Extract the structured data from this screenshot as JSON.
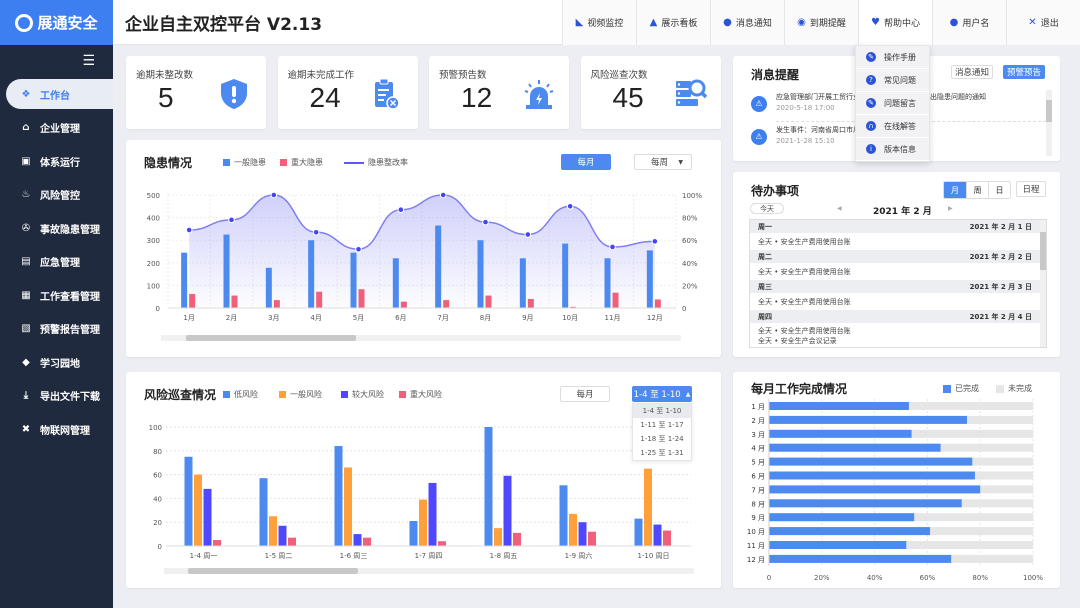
{
  "brand": {
    "name": "展通安全"
  },
  "app_title": "企业自主双控平台 V2.13",
  "nav": [
    {
      "label": "视频监控",
      "icon": "camera-icon"
    },
    {
      "label": "展示看板",
      "icon": "dashboard-icon"
    },
    {
      "label": "消息通知",
      "icon": "message-icon"
    },
    {
      "label": "到期提醒",
      "icon": "alarm-icon"
    },
    {
      "label": "帮助中心",
      "icon": "heart-icon"
    },
    {
      "label": "用户名",
      "icon": "user-icon"
    },
    {
      "label": "退出",
      "icon": "close-icon"
    }
  ],
  "help_menu": [
    {
      "label": "操作手册",
      "icon": "manual-icon"
    },
    {
      "label": "常见问题",
      "icon": "question-icon"
    },
    {
      "label": "问题留言",
      "icon": "edit-icon"
    },
    {
      "label": "在线解答",
      "icon": "headset-icon"
    },
    {
      "label": "版本信息",
      "icon": "info-icon"
    }
  ],
  "sidebar": {
    "items": [
      {
        "label": "工作台",
        "icon": "windows-icon",
        "active": true
      },
      {
        "label": "企业管理",
        "icon": "home-icon"
      },
      {
        "label": "体系运行",
        "icon": "system-icon"
      },
      {
        "label": "风险管控",
        "icon": "fire-icon"
      },
      {
        "label": "事故隐患管理",
        "icon": "hazard-icon"
      },
      {
        "label": "应急管理",
        "icon": "emergency-icon"
      },
      {
        "label": "工作查看管理",
        "icon": "calendar-icon"
      },
      {
        "label": "预警报告管理",
        "icon": "report-icon"
      },
      {
        "label": "学习园地",
        "icon": "graduation-icon"
      },
      {
        "label": "导出文件下载",
        "icon": "download-icon"
      },
      {
        "label": "物联网管理",
        "icon": "network-icon"
      }
    ]
  },
  "stats": [
    {
      "label": "逾期未整改数",
      "value": "5",
      "icon": "shield-alert-icon"
    },
    {
      "label": "逾期未完成工作",
      "value": "24",
      "icon": "clipboard-x-icon"
    },
    {
      "label": "预警预告数",
      "value": "12",
      "icon": "siren-icon"
    },
    {
      "label": "风险巡查次数",
      "value": "45",
      "icon": "server-search-icon"
    }
  ],
  "hazard": {
    "title": "隐患情况",
    "btn_monthly": "每月",
    "select_value": "每周",
    "legend": [
      "一般隐患",
      "重大隐患",
      "隐患整改率"
    ]
  },
  "messages": {
    "title": "消息提醒",
    "btn_notice": "消息通知",
    "btn_warning": "预警预告",
    "items": [
      {
        "text": "应急管理部门开展工贸行业…通报两个层面八类突出隐患问题的通知",
        "time": "2020-5-18   17:00"
      },
      {
        "text": "发生事件：河南省周口市川…测试",
        "time": "2021-1-28   15:10"
      }
    ]
  },
  "todo": {
    "title": "待办事项",
    "view_tabs": [
      "月",
      "周",
      "日"
    ],
    "btn_schedule": "日程",
    "btn_today": "今天",
    "month_label": "2021 年 2 月",
    "days": [
      {
        "weekday": "周一",
        "date": "2021 年 2 月 1 日",
        "events": [
          "全天 • 安全生产费用使用台账"
        ]
      },
      {
        "weekday": "周二",
        "date": "2021 年 2 月 2 日",
        "events": [
          "全天 • 安全生产费用使用台账"
        ]
      },
      {
        "weekday": "周三",
        "date": "2021 年 2 月 3 日",
        "events": [
          "全天 • 安全生产费用使用台账"
        ]
      },
      {
        "weekday": "周四",
        "date": "2021 年 2 月 4 日",
        "events": [
          "全天 • 安全生产费用使用台账",
          "全天 • 安全生产会议记录"
        ]
      }
    ]
  },
  "risk": {
    "title": "风险巡查情况",
    "btn_monthly": "每月",
    "select_value": "1-4 至 1-10",
    "options": [
      "1-4 至 1-10",
      "1-11 至 1-17",
      "1-18 至 1-24",
      "1-25 至 1-31"
    ],
    "legend": [
      "低风险",
      "一般风险",
      "较大风险",
      "重大风险"
    ]
  },
  "completion": {
    "title": "每月工作完成情况",
    "legend": [
      "已完成",
      "未完成"
    ]
  },
  "colors": {
    "accent": "#4d8af0",
    "red": "#f0607a",
    "orange": "#ffa03a",
    "purple": "#5048ff",
    "line": "#5b5bf0"
  },
  "chart_data": [
    {
      "type": "bar",
      "title": "隐患情况",
      "categories": [
        "1月",
        "2月",
        "3月",
        "4月",
        "5月",
        "6月",
        "7月",
        "8月",
        "9月",
        "10月",
        "11月",
        "12月"
      ],
      "series": [
        {
          "name": "一般隐患",
          "type": "bar",
          "values": [
            245,
            325,
            178,
            300,
            245,
            220,
            365,
            300,
            220,
            285,
            220,
            255
          ]
        },
        {
          "name": "重大隐患",
          "type": "bar",
          "values": [
            62,
            55,
            35,
            72,
            83,
            28,
            35,
            55,
            40,
            5,
            68,
            38
          ]
        },
        {
          "name": "隐患整改率",
          "type": "line",
          "axis": "right",
          "values": [
            69,
            78,
            100,
            67,
            52,
            87,
            100,
            76,
            65,
            90,
            54,
            59
          ]
        }
      ],
      "ylim": [
        0,
        500
      ],
      "yticks": [
        0,
        100,
        200,
        300,
        400,
        500
      ],
      "y2lim": [
        0,
        100
      ],
      "y2ticks": [
        "0",
        "20%",
        "40%",
        "60%",
        "80%",
        "100%"
      ]
    },
    {
      "type": "bar",
      "title": "风险巡查情况",
      "categories": [
        "1-4  周一",
        "1-5  周二",
        "1-6  周三",
        "1-7  周四",
        "1-8  周五",
        "1-9  周六",
        "1-10  周日"
      ],
      "series": [
        {
          "name": "低风险",
          "values": [
            75,
            57,
            84,
            21,
            100,
            51,
            23
          ]
        },
        {
          "name": "一般风险",
          "values": [
            60,
            25,
            66,
            39,
            15,
            27,
            65
          ]
        },
        {
          "name": "较大风险",
          "values": [
            48,
            17,
            10,
            53,
            59,
            20,
            18
          ]
        },
        {
          "name": "重大风险",
          "values": [
            5,
            7,
            7,
            4,
            11,
            12,
            13
          ]
        }
      ],
      "ylim": [
        0,
        100
      ],
      "yticks": [
        0,
        20,
        40,
        60,
        80,
        100
      ]
    },
    {
      "type": "bar",
      "orientation": "horizontal",
      "title": "每月工作完成情况",
      "categories": [
        "1 月",
        "2 月",
        "3 月",
        "4 月",
        "5 月",
        "6 月",
        "7 月",
        "8 月",
        "9 月",
        "10 月",
        "11 月",
        "12 月"
      ],
      "series": [
        {
          "name": "已完成",
          "values": [
            53,
            75,
            54,
            65,
            77,
            78,
            80,
            73,
            55,
            61,
            52,
            69
          ]
        },
        {
          "name": "未完成",
          "values": [
            47,
            25,
            46,
            35,
            23,
            22,
            20,
            27,
            45,
            39,
            48,
            31
          ]
        }
      ],
      "xlim": [
        0,
        100
      ],
      "xticks": [
        "0",
        "20%",
        "40%",
        "60%",
        "80%",
        "100%"
      ]
    }
  ]
}
